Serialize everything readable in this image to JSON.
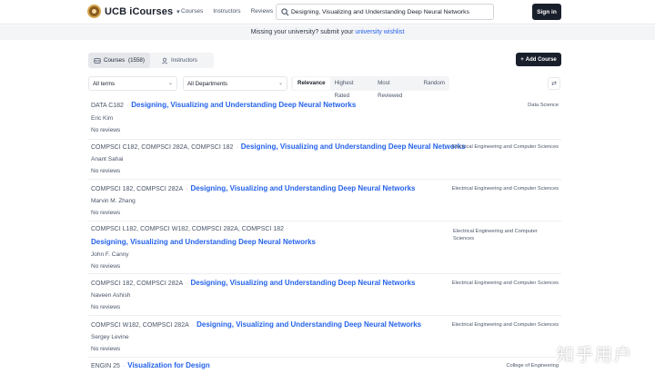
{
  "header": {
    "brand": "UCB iCourses",
    "nav": [
      "Courses",
      "Instructors",
      "Reviews"
    ],
    "search_value": "Designing, Visualizing and Understanding Deep Neural Networks",
    "signin_label": "Sign in"
  },
  "banner": {
    "text": "Missing your university? submit your ",
    "link": "university wishlist"
  },
  "tabs": {
    "courses_label": "Courses",
    "courses_count": "(1558)",
    "instructors_label": "Instructors"
  },
  "add_course_label": "Add Course",
  "filters": {
    "terms": "All terms",
    "departments": "All Departments"
  },
  "sort_options": [
    "Relevance",
    "Highest Rated",
    "Most Reviewed",
    "Random"
  ],
  "results": [
    {
      "codes": "DATA C182",
      "title": "Designing, Visualizing and Understanding Deep Neural Networks",
      "dept": "Data Science",
      "instructor": "Eric Kim",
      "reviews": "No reviews"
    },
    {
      "codes": "COMPSCI C182, COMPSCI 282A, COMPSCI 182",
      "title": "Designing, Visualizing and Understanding Deep Neural Networks",
      "dept": "Electrical Engineering and Computer Sciences",
      "instructor": "Anant Sahai",
      "reviews": "No reviews"
    },
    {
      "codes": "COMPSCI 182, COMPSCI 282A",
      "title": "Designing, Visualizing and Understanding Deep Neural Networks",
      "dept": "Electrical Engineering and Computer Sciences",
      "instructor": "Marvin M. Zhang",
      "reviews": "No reviews"
    },
    {
      "codes": "COMPSCI L182, COMPSCI W182, COMPSCI 282A, COMPSCI 182",
      "title": "Designing, Visualizing and Understanding Deep Neural Networks",
      "dept": "Electrical Engineering and Computer Sciences",
      "instructor": "John F. Canny",
      "reviews": "No reviews"
    },
    {
      "codes": "COMPSCI 182, COMPSCI 282A",
      "title": "Designing, Visualizing and Understanding Deep Neural Networks",
      "dept": "Electrical Engineering and Computer Sciences",
      "instructor": "Naveen Ashish",
      "reviews": "No reviews"
    },
    {
      "codes": "COMPSCI W182, COMPSCI 282A",
      "title": "Designing, Visualizing and Understanding Deep Neural Networks",
      "dept": "Electrical Engineering and Computer Sciences",
      "instructor": "Sergey Levine",
      "reviews": "No reviews"
    },
    {
      "codes": "ENGIN 25",
      "title": "Visualization for Design",
      "dept": "College of Engineering",
      "instructor": "",
      "reviews": ""
    }
  ],
  "watermark": "知乎用户",
  "colors": {
    "accent": "#2563eb",
    "dark": "#1a1f2c"
  }
}
